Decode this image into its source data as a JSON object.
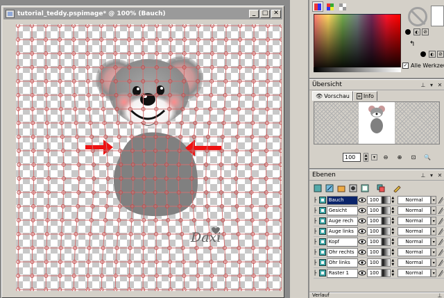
{
  "document_window": {
    "title": "tutorial_teddy.pspimage* @ 100% (Bauch)",
    "minimize_glyph": "_",
    "maximize_glyph": "□",
    "close_glyph": "✕",
    "watermark": "Daxi"
  },
  "materials_panel": {
    "all_tools_checkbox_label": "Alle Werkzeuge",
    "all_tools_checked": true,
    "foreground_color": "#000000",
    "background_color": "#ffffff"
  },
  "overview_panel": {
    "title": "Übersicht",
    "tabs": [
      {
        "label": "Vorschau",
        "icon": "eye-icon"
      },
      {
        "label": "Info",
        "icon": "info-icon"
      }
    ],
    "zoom_value": "100"
  },
  "layers_panel": {
    "title": "Ebenen",
    "layers": [
      {
        "name": "Bauch",
        "opacity": "100",
        "blend": "Normal"
      },
      {
        "name": "Gesicht",
        "opacity": "100",
        "blend": "Normal"
      },
      {
        "name": "Auge rech",
        "opacity": "100",
        "blend": "Normal"
      },
      {
        "name": "Auge links",
        "opacity": "100",
        "blend": "Normal"
      },
      {
        "name": "Kopf",
        "opacity": "100",
        "blend": "Normal"
      },
      {
        "name": "Ohr rechts",
        "opacity": "100",
        "blend": "Normal"
      },
      {
        "name": "Ohr links",
        "opacity": "100",
        "blend": "Normal"
      },
      {
        "name": "Raster 1",
        "opacity": "100",
        "blend": "Normal"
      }
    ]
  },
  "bottom_panel": {
    "title": "Verlauf"
  }
}
